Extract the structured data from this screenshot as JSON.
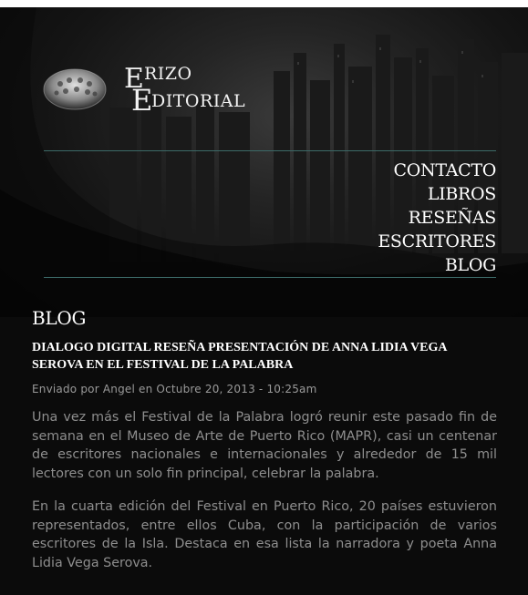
{
  "logo": {
    "line1_initial": "E",
    "line1_rest": "RIZO",
    "line2_initial": "E",
    "line2_rest": "DITORIAL"
  },
  "nav": {
    "items": [
      {
        "label": "CONTACTO"
      },
      {
        "label": "LIBROS"
      },
      {
        "label": "RESEÑAS"
      },
      {
        "label": "ESCRITORES"
      },
      {
        "label": "BLOG"
      }
    ]
  },
  "blog": {
    "section_title": "BLOG",
    "post": {
      "title": "DIALOGO DIGITAL RESEÑA PRESENTACIÓN DE ANNA LIDIA VEGA SEROVA EN EL FESTIVAL DE LA PALABRA",
      "meta": "Enviado por Angel en Octubre 20, 2013 - 10:25am",
      "paragraphs": [
        "Una vez más el Festival de la Palabra logró reunir este pasado fin de semana en el Museo de Arte de Puerto Rico (MAPR), casi un centenar de escritores nacionales e internacionales y alrededor de 15 mil lectores con un solo fin principal, celebrar la palabra.",
        "En la cuarta edición del Festival en Puerto Rico, 20 países estuvieron representados, entre ellos Cuba, con la participación de varios escritores de la Isla. Destaca en esa lista la narradora y poeta Anna Lidia Vega Serova."
      ]
    }
  },
  "colors": {
    "background": "#0b0b0b",
    "divider": "#3c6a68",
    "text_primary": "#ffffff",
    "text_body": "#8e8e8e",
    "text_meta": "#9a9a9a"
  }
}
